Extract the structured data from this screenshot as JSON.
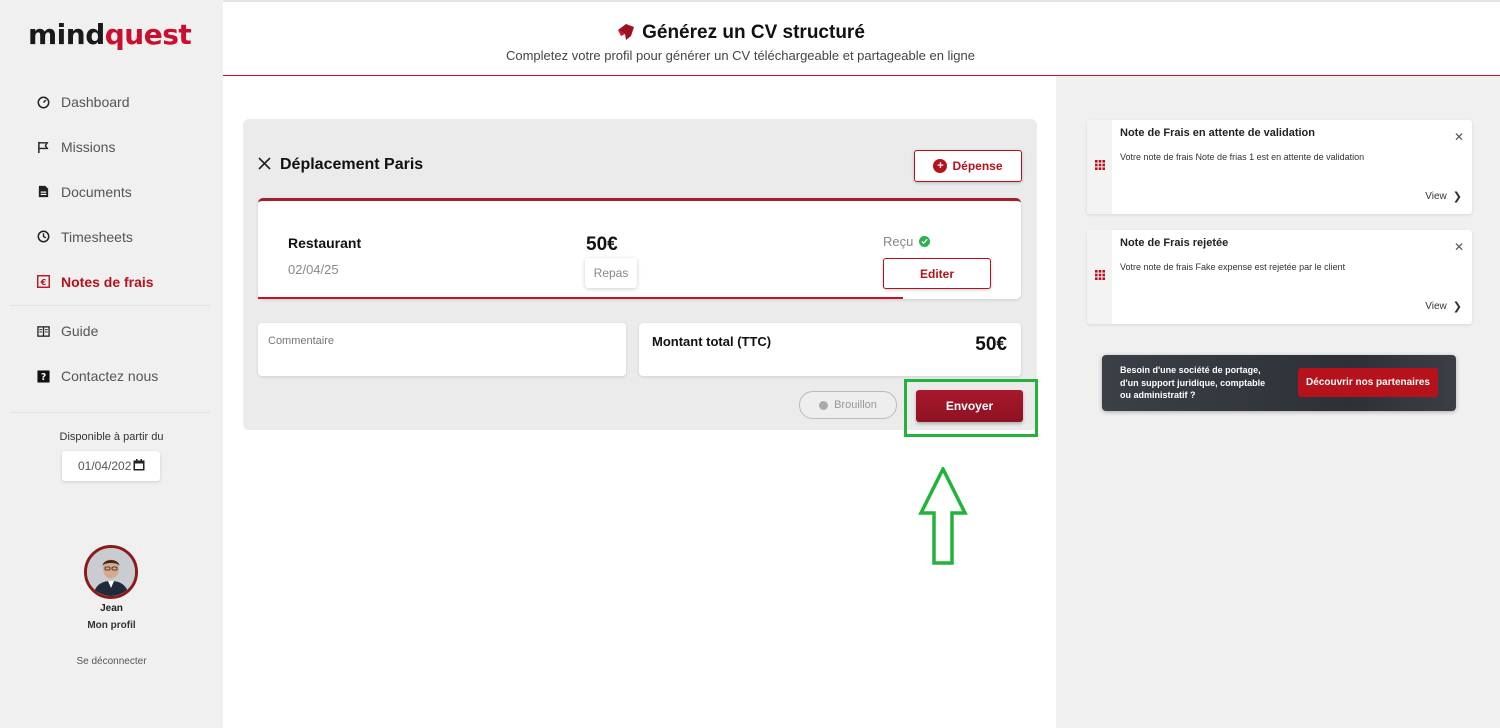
{
  "brand": {
    "logo_part1": "mind",
    "logo_part2": "quest",
    "accent": "#b5121b"
  },
  "sidebar": {
    "items": [
      {
        "label": "Dashboard",
        "icon": "gauge-icon"
      },
      {
        "label": "Missions",
        "icon": "flag-icon"
      },
      {
        "label": "Documents",
        "icon": "document-icon"
      },
      {
        "label": "Timesheets",
        "icon": "clock-icon"
      },
      {
        "label": "Notes de frais",
        "icon": "euro-icon",
        "active": true
      },
      {
        "label": "Guide",
        "icon": "book-icon"
      },
      {
        "label": "Contactez nous",
        "icon": "question-icon"
      }
    ],
    "availability_label": "Disponible à partir du",
    "availability_date": "01/04/202",
    "profile_name": "Jean",
    "profile_link": "Mon profil",
    "logout": "Se déconnecter"
  },
  "header": {
    "title": "Générez un CV structuré",
    "subtitle": "Completez votre profil pour générer un CV téléchargeable et partageable en ligne"
  },
  "report": {
    "title": "Déplacement Paris",
    "add_expense_label": "Dépense",
    "expense": {
      "name": "Restaurant",
      "date": "02/04/25",
      "amount": "50€",
      "category": "Repas",
      "status": "Reçu",
      "edit_label": "Editer"
    },
    "comment_placeholder": "Commentaire",
    "total_label": "Montant total (TTC)",
    "total_value": "50€",
    "draft_label": "Brouillon",
    "send_label": "Envoyer"
  },
  "notifications": [
    {
      "title": "Note de Frais en attente de validation",
      "text": "Votre note de frais Note de frias 1 est en attente de validation",
      "view": "View"
    },
    {
      "title": "Note de Frais rejetée",
      "text": "Votre note de frais Fake expense est rejetée par le client",
      "view": "View"
    }
  ],
  "banner": {
    "line1": "Besoin d'une société de portage,",
    "line2": "d'un support juridique, comptable",
    "line3": "ou administratif ?",
    "button": "Découvrir nos partenaires"
  },
  "annotation": {
    "highlight_color": "#22b33a"
  }
}
